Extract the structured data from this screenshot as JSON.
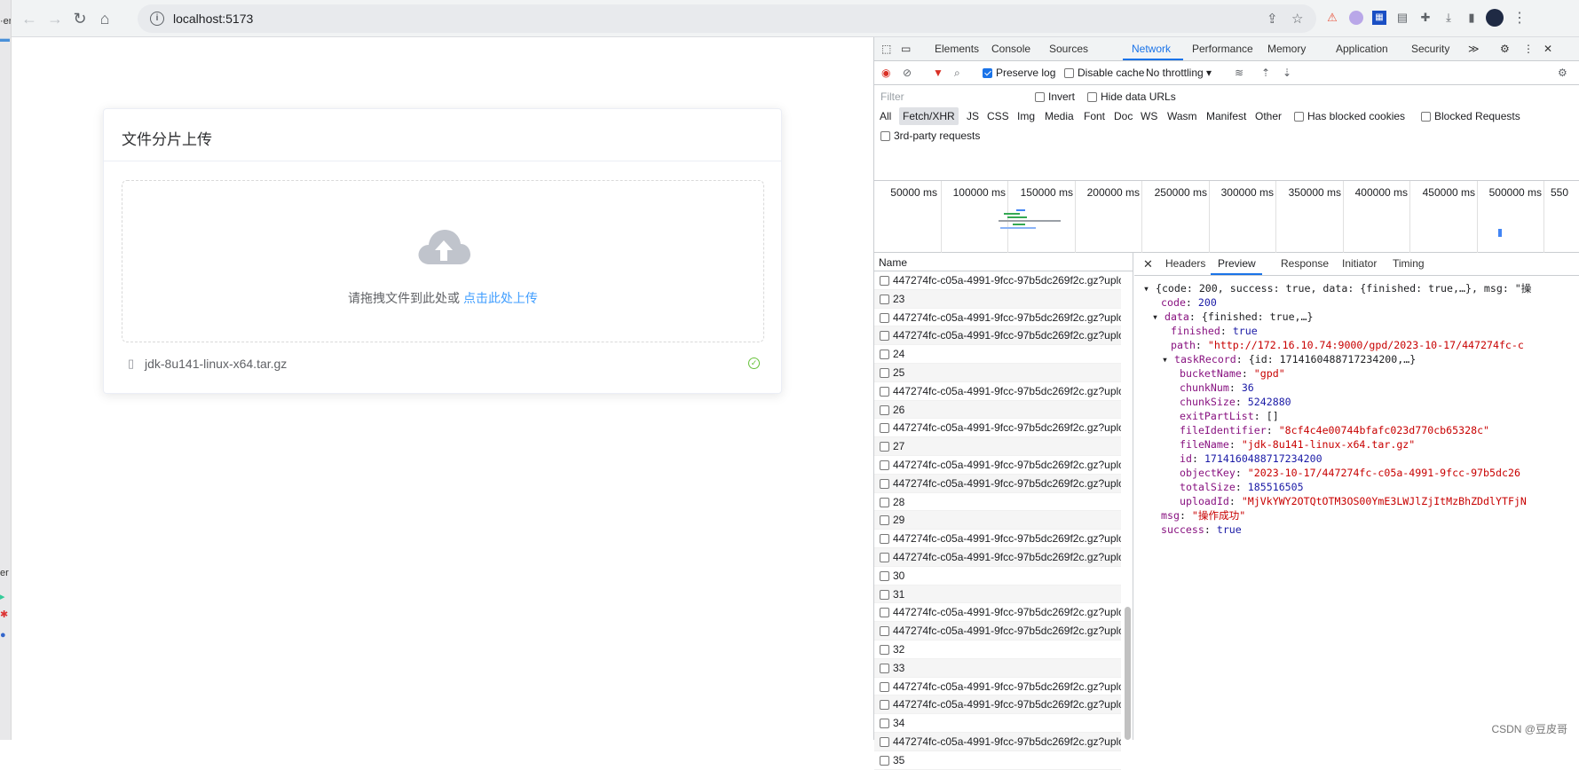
{
  "browser": {
    "url": "localhost:5173"
  },
  "upload_card": {
    "title": "文件分片上传",
    "drop_text": "请拖拽文件到此处或",
    "click_text": "点击此处上传",
    "file_name": "jdk-8u141-linux-x64.tar.gz"
  },
  "devtools": {
    "tabs": [
      "Elements",
      "Console",
      "Sources",
      "Network",
      "Performance",
      "Memory",
      "Application",
      "Security"
    ],
    "more": "≫",
    "toolbar": {
      "preserve_log": "Preserve log",
      "disable_cache": "Disable cache",
      "throttling": "No throttling"
    },
    "filter": {
      "placeholder": "Filter",
      "invert": "Invert",
      "hide_data_urls": "Hide data URLs"
    },
    "types": [
      "All",
      "Fetch/XHR",
      "JS",
      "CSS",
      "Img",
      "Media",
      "Font",
      "Doc",
      "WS",
      "Wasm",
      "Manifest",
      "Other"
    ],
    "has_blocked_cookies": "Has blocked cookies",
    "blocked_requests": "Blocked Requests",
    "third_party": "3rd-party requests",
    "timeline_ticks": [
      "50000 ms",
      "100000 ms",
      "150000 ms",
      "200000 ms",
      "250000 ms",
      "300000 ms",
      "350000 ms",
      "400000 ms",
      "450000 ms",
      "500000 ms",
      "550"
    ],
    "list_header": "Name",
    "requests": [
      "447274fc-c05a-4991-9fcc-97b5dc269f2c.gz?uplo…",
      "23",
      "447274fc-c05a-4991-9fcc-97b5dc269f2c.gz?uplo…",
      "447274fc-c05a-4991-9fcc-97b5dc269f2c.gz?uplo…",
      "24",
      "25",
      "447274fc-c05a-4991-9fcc-97b5dc269f2c.gz?uplo…",
      "26",
      "447274fc-c05a-4991-9fcc-97b5dc269f2c.gz?uplo…",
      "27",
      "447274fc-c05a-4991-9fcc-97b5dc269f2c.gz?uplo…",
      "447274fc-c05a-4991-9fcc-97b5dc269f2c.gz?uplo…",
      "28",
      "29",
      "447274fc-c05a-4991-9fcc-97b5dc269f2c.gz?uplo…",
      "447274fc-c05a-4991-9fcc-97b5dc269f2c.gz?uplo…",
      "30",
      "31",
      "447274fc-c05a-4991-9fcc-97b5dc269f2c.gz?uplo…",
      "447274fc-c05a-4991-9fcc-97b5dc269f2c.gz?uplo…",
      "32",
      "33",
      "447274fc-c05a-4991-9fcc-97b5dc269f2c.gz?uplo…",
      "447274fc-c05a-4991-9fcc-97b5dc269f2c.gz?uplo…",
      "34",
      "447274fc-c05a-4991-9fcc-97b5dc269f2c.gz?uplo…",
      "35"
    ],
    "preview_tabs": [
      "Headers",
      "Preview",
      "Response",
      "Initiator",
      "Timing"
    ],
    "preview": {
      "summary": "{code: 200, success: true, data: {finished: true,…}, msg: \"操",
      "code": "200",
      "data_summary": "{finished: true,…}",
      "finished": "true",
      "path": "\"http://172.16.10.74:9000/gpd/2023-10-17/447274fc-c",
      "taskRecord_summary": "{id: 1714160488717234200,…}",
      "bucketName": "\"gpd\"",
      "chunkNum": "36",
      "chunkSize": "5242880",
      "exitPartList": "[]",
      "fileIdentifier": "\"8cf4c4e00744bfafc023d770cb65328c\"",
      "fileName": "\"jdk-8u141-linux-x64.tar.gz\"",
      "id": "1714160488717234200",
      "objectKey": "\"2023-10-17/447274fc-c05a-4991-9fcc-97b5dc26",
      "totalSize": "185516505",
      "uploadId": "\"MjVkYWY2OTQtOTM3OS00YmE3LWJlZjItMzBhZDdlYTFjN",
      "msg": "\"操作成功\"",
      "success": "true"
    }
  },
  "watermark": "CSDN @豆皮哥"
}
